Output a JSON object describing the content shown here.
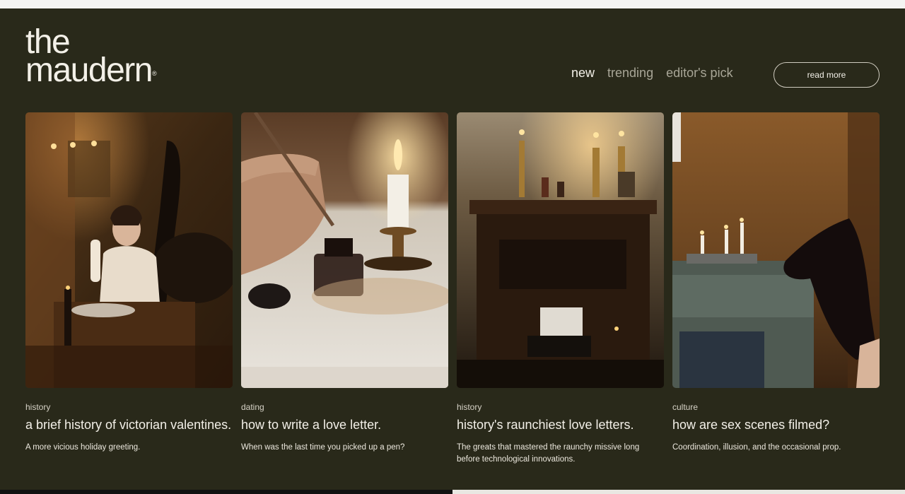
{
  "brand": {
    "line1": "the",
    "line2": "maudern",
    "mark": "®"
  },
  "nav": {
    "items": [
      {
        "label": "new"
      },
      {
        "label": "trending"
      },
      {
        "label": "editor's pick"
      }
    ],
    "cta": "read more"
  },
  "cards": [
    {
      "category": "history",
      "title": "a brief history of victorian valentines.",
      "description": "A more vicious holiday greeting."
    },
    {
      "category": "dating",
      "title": "how to write a love letter.",
      "description": "When was the last time you picked up a pen?"
    },
    {
      "category": "history",
      "title": "history's raunchiest love letters.",
      "description": "The greats that mastered the raunchy missive long before technological innovations."
    },
    {
      "category": "culture",
      "title": "how are sex scenes filmed?",
      "description": "Coordination, illusion, and the occasional prop."
    }
  ],
  "colors": {
    "background": "#29291a",
    "text": "#f3f0e8",
    "muted": "#a8a697"
  }
}
